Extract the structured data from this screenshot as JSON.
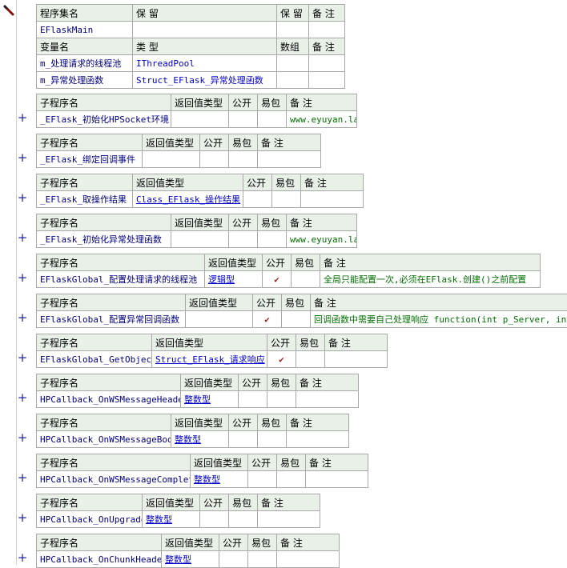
{
  "program_set": {
    "headers": [
      "程序集名",
      "保 留",
      "保 留",
      "备 注"
    ],
    "name": "EFlaskMain"
  },
  "variables": {
    "headers": [
      "变量名",
      "类 型",
      "数组",
      "备 注"
    ],
    "rows": [
      {
        "name": "m_处理请求的线程池",
        "type": "IThreadPool"
      },
      {
        "name": "m_异常处理函数",
        "type": "Struct_EFlask_异常处理函数"
      }
    ]
  },
  "sub_header_labels": {
    "name": "子程序名",
    "return_type": "返回值类型",
    "public": "公开",
    "easy": "易包",
    "note": "备 注"
  },
  "subroutines": [
    {
      "name": "_EFlask_初始化HPSocket环境",
      "return_type": "",
      "public": "",
      "note": "www.eyuyan.la"
    },
    {
      "name": "_EFlask_绑定回调事件",
      "return_type": "",
      "public": "",
      "note": ""
    },
    {
      "name": "_EFlask_取操作结果",
      "return_type": "Class_EFlask_操作结果",
      "public": "",
      "note": ""
    },
    {
      "name": "_EFlask_初始化异常处理函数",
      "return_type": "",
      "public": "",
      "note": "www.eyuyan.la"
    },
    {
      "name": "EFlaskGlobal_配置处理请求的线程池",
      "return_type": "逻辑型",
      "public": "✔",
      "note": "全局只能配置一次,必须在EFlask.创建()之前配置"
    },
    {
      "name": "EFlaskGlobal_配置异常回调函数",
      "return_type": "",
      "public": "✔",
      "note": "回调函数中需要自己处理响应 function(int p_Server, int p"
    },
    {
      "name": "EFlaskGlobal_GetObject",
      "return_type": "Struct_EFlask_请求响应",
      "public": "✔",
      "note": ""
    },
    {
      "name": "HPCallback_OnWSMessageHeader",
      "return_type": "整数型",
      "public": "",
      "note": ""
    },
    {
      "name": "HPCallback_OnWSMessageBody",
      "return_type": "整数型",
      "public": "",
      "note": ""
    },
    {
      "name": "HPCallback_OnWSMessageComplete",
      "return_type": "整数型",
      "public": "",
      "note": ""
    },
    {
      "name": "HPCallback_OnUpgrade",
      "return_type": "整数型",
      "public": "",
      "note": ""
    },
    {
      "name": "HPCallback_OnChunkHeader",
      "return_type": "整数型",
      "public": "",
      "note": ""
    }
  ],
  "expand_symbol": "+",
  "colors": {
    "header_bg": "#e8f0e8",
    "name_text": "#000080",
    "type_text": "#0000cc",
    "note_text": "#007000",
    "check_mark": "#9c1c1c"
  }
}
